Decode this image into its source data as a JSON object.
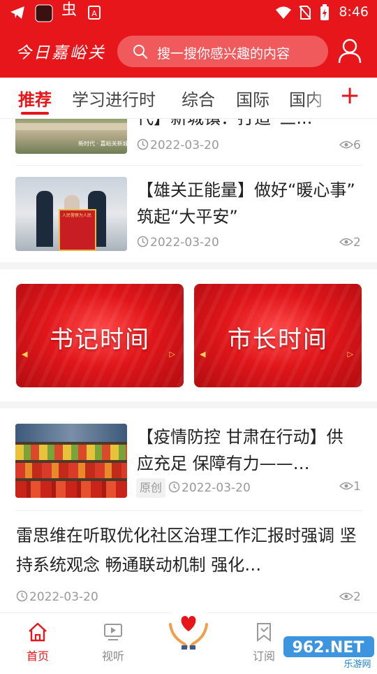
{
  "status_bar": {
    "time": "8:46"
  },
  "header": {
    "logo_text": "今日嘉峪关",
    "search_placeholder": "搜一搜你感兴趣的内容"
  },
  "tabs": [
    {
      "label": "推荐"
    },
    {
      "label": "学习进行时"
    },
    {
      "label": "综合"
    },
    {
      "label": "国际"
    },
    {
      "label": "国内"
    }
  ],
  "tab_add_label": "+",
  "feed": {
    "item1": {
      "title": "代】新城镇：打造“三...",
      "date": "2022-03-20",
      "views": "6",
      "thumb_caption": "新时代 · 嘉峪关新城镇 · 奋进新时代"
    },
    "item2": {
      "title": "【雄关正能量】做好“暖心事” 筑起“大平安”",
      "date": "2022-03-20",
      "views": "2",
      "banner_text": "人民警察为人民"
    },
    "banners": [
      {
        "label": "书记时间"
      },
      {
        "label": "市长时间"
      }
    ],
    "item3": {
      "title": "【疫情防控 甘肃在行动】供应充足 保障有力——…",
      "tag": "原创",
      "date": "2022-03-20",
      "views": "1"
    },
    "item4": {
      "title": "雷思维在听取优化社区治理工作汇报时强调 坚持系统观念 畅通联动机制 强化…",
      "date": "2022-03-20",
      "views": "2"
    }
  },
  "bottom_nav": [
    {
      "label": "首页"
    },
    {
      "label": "视听"
    },
    {
      "label": "订阅"
    }
  ],
  "watermark": {
    "brand": "962.NET",
    "sub": "乐游网"
  },
  "colors": {
    "brand_red": "#e7161b",
    "meta_gray": "#999999"
  },
  "icons": [
    "telegram-icon",
    "app-icon",
    "chong-icon",
    "a-icon",
    "wifi-icon",
    "no-sim-icon",
    "battery-icon",
    "search-icon",
    "user-icon",
    "clock-icon",
    "eye-icon",
    "home-icon",
    "video-icon",
    "heart-hands-icon",
    "bookmark-icon"
  ]
}
